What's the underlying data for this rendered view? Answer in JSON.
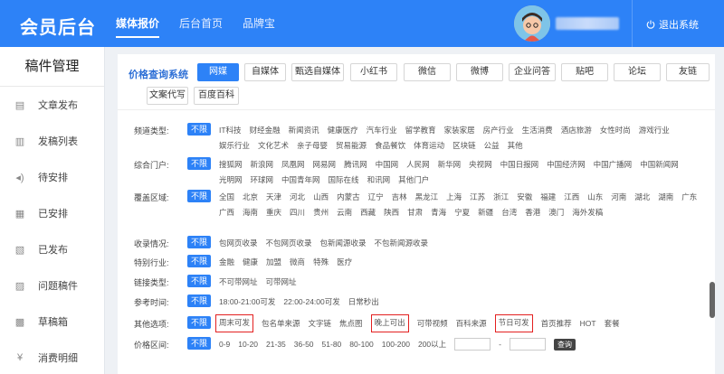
{
  "app": {
    "title": "会员后台"
  },
  "topnav": [
    {
      "label": "媒体报价",
      "active": true
    },
    {
      "label": "后台首页",
      "active": false
    },
    {
      "label": "品牌宝",
      "active": false
    }
  ],
  "user": {
    "logout_label": "退出系统"
  },
  "sidebar": {
    "title": "稿件管理",
    "items": [
      {
        "label": "文章发布",
        "icon": "document-icon"
      },
      {
        "label": "发稿列表",
        "icon": "list-icon"
      },
      {
        "label": "待安排",
        "icon": "speaker-icon"
      },
      {
        "label": "已安排",
        "icon": "calendar-icon"
      },
      {
        "label": "已发布",
        "icon": "published-icon"
      },
      {
        "label": "问题稿件",
        "icon": "warning-icon"
      },
      {
        "label": "草稿箱",
        "icon": "draft-icon"
      },
      {
        "label": "消费明细",
        "icon": "money-icon"
      }
    ]
  },
  "channels": {
    "label": "价格查询系统",
    "row1": [
      "网媒",
      "自媒体",
      "甄选自媒体",
      "小红书",
      "微信",
      "微博",
      "企业问答",
      "贴吧",
      "论坛",
      "友链"
    ],
    "row2": [
      "文案代写",
      "百度百科"
    ],
    "active": "网媒"
  },
  "filters": {
    "all_label": "不限",
    "channel_type": {
      "label": "频道类型:",
      "options": [
        "IT科技",
        "财经金融",
        "新闻资讯",
        "健康医疗",
        "汽车行业",
        "留学教育",
        "家装家居",
        "房产行业",
        "生活消费",
        "酒店旅游",
        "女性时尚",
        "游戏行业",
        "娱乐行业",
        "文化艺术",
        "亲子母婴",
        "贸易能源",
        "食品餐饮",
        "体育运动",
        "区块链",
        "公益",
        "其他"
      ]
    },
    "portal": {
      "label": "综合门户:",
      "options": [
        "搜狐网",
        "新浪网",
        "凤凰网",
        "网易网",
        "腾讯网",
        "中国网",
        "人民网",
        "新华网",
        "央视网",
        "中国日报网",
        "中国经济网",
        "中国广播网",
        "中国新闻网",
        "光明网",
        "环球网",
        "中国青年网",
        "国际在线",
        "和讯网",
        "其他门户"
      ]
    },
    "region": {
      "label": "覆盖区域:",
      "options": [
        "全国",
        "北京",
        "天津",
        "河北",
        "山西",
        "内蒙古",
        "辽宁",
        "吉林",
        "黑龙江",
        "上海",
        "江苏",
        "浙江",
        "安徽",
        "福建",
        "江西",
        "山东",
        "河南",
        "湖北",
        "湖南",
        "广东",
        "广西",
        "海南",
        "重庆",
        "四川",
        "贵州",
        "云南",
        "西藏",
        "陕西",
        "甘肃",
        "青海",
        "宁夏",
        "新疆",
        "台湾",
        "香港",
        "澳门",
        "海外发稿"
      ]
    },
    "inclusion": {
      "label": "收录情况:",
      "options": [
        "包网页收录",
        "不包网页收录",
        "包新闻源收录",
        "不包新闻源收录"
      ]
    },
    "special": {
      "label": "特别行业:",
      "options": [
        "金融",
        "健康",
        "加盟",
        "微商",
        "特殊",
        "医疗"
      ]
    },
    "link": {
      "label": "链接类型:",
      "options": [
        "不可带网址",
        "可带网址"
      ]
    },
    "ref_time": {
      "label": "参考时间:",
      "options": [
        "18:00-21:00可发",
        "22:00-24:00可发",
        "日常秒出"
      ]
    },
    "other": {
      "label": "其他选项:",
      "options": [
        "周末可发",
        "包名单来源",
        "文字链",
        "焦点图",
        "晚上可出",
        "可带视频",
        "百科来源",
        "节日可发",
        "首页推荐",
        "HOT",
        "套餐"
      ],
      "highlighted": [
        "周末可发",
        "晚上可出",
        "节日可发"
      ]
    },
    "price": {
      "label": "价格区间:",
      "options": [
        "0-9",
        "10-20",
        "21-35",
        "36-50",
        "51-80",
        "80-100",
        "100-200",
        "200以上"
      ],
      "separator": "-",
      "query_label": "查询"
    }
  }
}
